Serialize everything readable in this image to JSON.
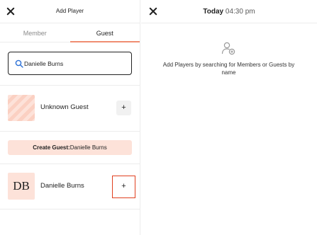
{
  "left_panel": {
    "title": "Add Player",
    "tabs": {
      "member": "Member",
      "guest": "Guest",
      "active": "Guest"
    },
    "search": {
      "value": "Danielle Burns",
      "placeholder": ""
    },
    "results": [
      {
        "name": "Unknown Guest",
        "add_label": "+",
        "avatar": "striped-placeholder"
      },
      {
        "name": "Danielle Burns",
        "initials": "DB",
        "add_label": "+"
      }
    ],
    "create_guest": {
      "prefix": "Create Guest:",
      "name": "Danielle Burns"
    }
  },
  "right_panel": {
    "title_day": "Today",
    "title_time": "04:30 pm",
    "empty_message": "Add Players by searching for Members or Guests by name",
    "empty_icon": "add-person-icon"
  },
  "colors": {
    "accent": "#f08d72",
    "avatar_bg": "#fde2d9",
    "highlight": "#e0401f",
    "button_bg": "#f1f1f1"
  }
}
